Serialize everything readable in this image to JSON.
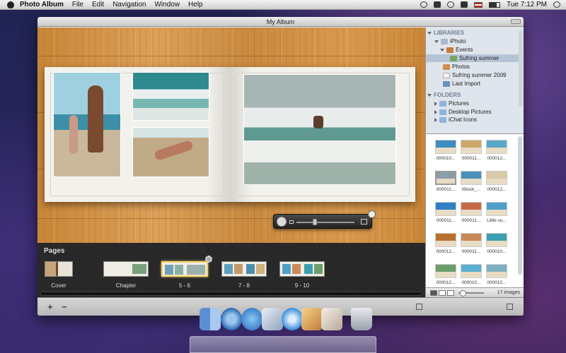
{
  "menubar": {
    "app_name": "Photo Album",
    "menus": [
      "File",
      "Edit",
      "Navigation",
      "Window",
      "Help"
    ],
    "clock": "Tue 7:12 PM"
  },
  "window": {
    "title": "My Album"
  },
  "pages_panel": {
    "header": "Pages",
    "thumbs": [
      {
        "label": "Cover",
        "selected": false
      },
      {
        "label": "Chapter",
        "selected": false
      },
      {
        "label": "5 - 6",
        "selected": true
      },
      {
        "label": "7 - 8",
        "selected": false
      },
      {
        "label": "9 - 10",
        "selected": false
      }
    ]
  },
  "sidebar": {
    "libraries_header": "LIBRARIES",
    "iphoto": "iPhoto",
    "events": "Events",
    "selected_event": "Sufring summer",
    "photos": "Photos",
    "summer_2009": "Sufring summer 2009",
    "last_import": "Last Import",
    "folders_header": "FOLDERS",
    "pictures": "Pictures",
    "desktop_pictures": "Desktop Pictures",
    "ichat_icons": "iChat Icons"
  },
  "browser": {
    "items": [
      {
        "label": "000010...",
        "color": "#3e8bbf"
      },
      {
        "label": "000011...",
        "color": "#c9a86a"
      },
      {
        "label": "000012...",
        "color": "#5aa7c8"
      },
      {
        "label": "000011...",
        "color": "#8a9da8"
      },
      {
        "label": "iStock_...",
        "color": "#4a90b8"
      },
      {
        "label": "000012...",
        "color": "#d8c9a8"
      },
      {
        "label": "000011...",
        "color": "#2f7fc4"
      },
      {
        "label": "000011...",
        "color": "#c76a4a"
      },
      {
        "label": "Little su...",
        "color": "#4fa0c9"
      },
      {
        "label": "000012...",
        "color": "#b8702e"
      },
      {
        "label": "000011...",
        "color": "#c98a5a"
      },
      {
        "label": "000010...",
        "color": "#3c9fb0"
      },
      {
        "label": "000012...",
        "color": "#6b9e6b"
      },
      {
        "label": "000010...",
        "color": "#5ab0d0"
      },
      {
        "label": "000012...",
        "color": "#7fb0c0"
      }
    ],
    "count_label": "17 images"
  }
}
